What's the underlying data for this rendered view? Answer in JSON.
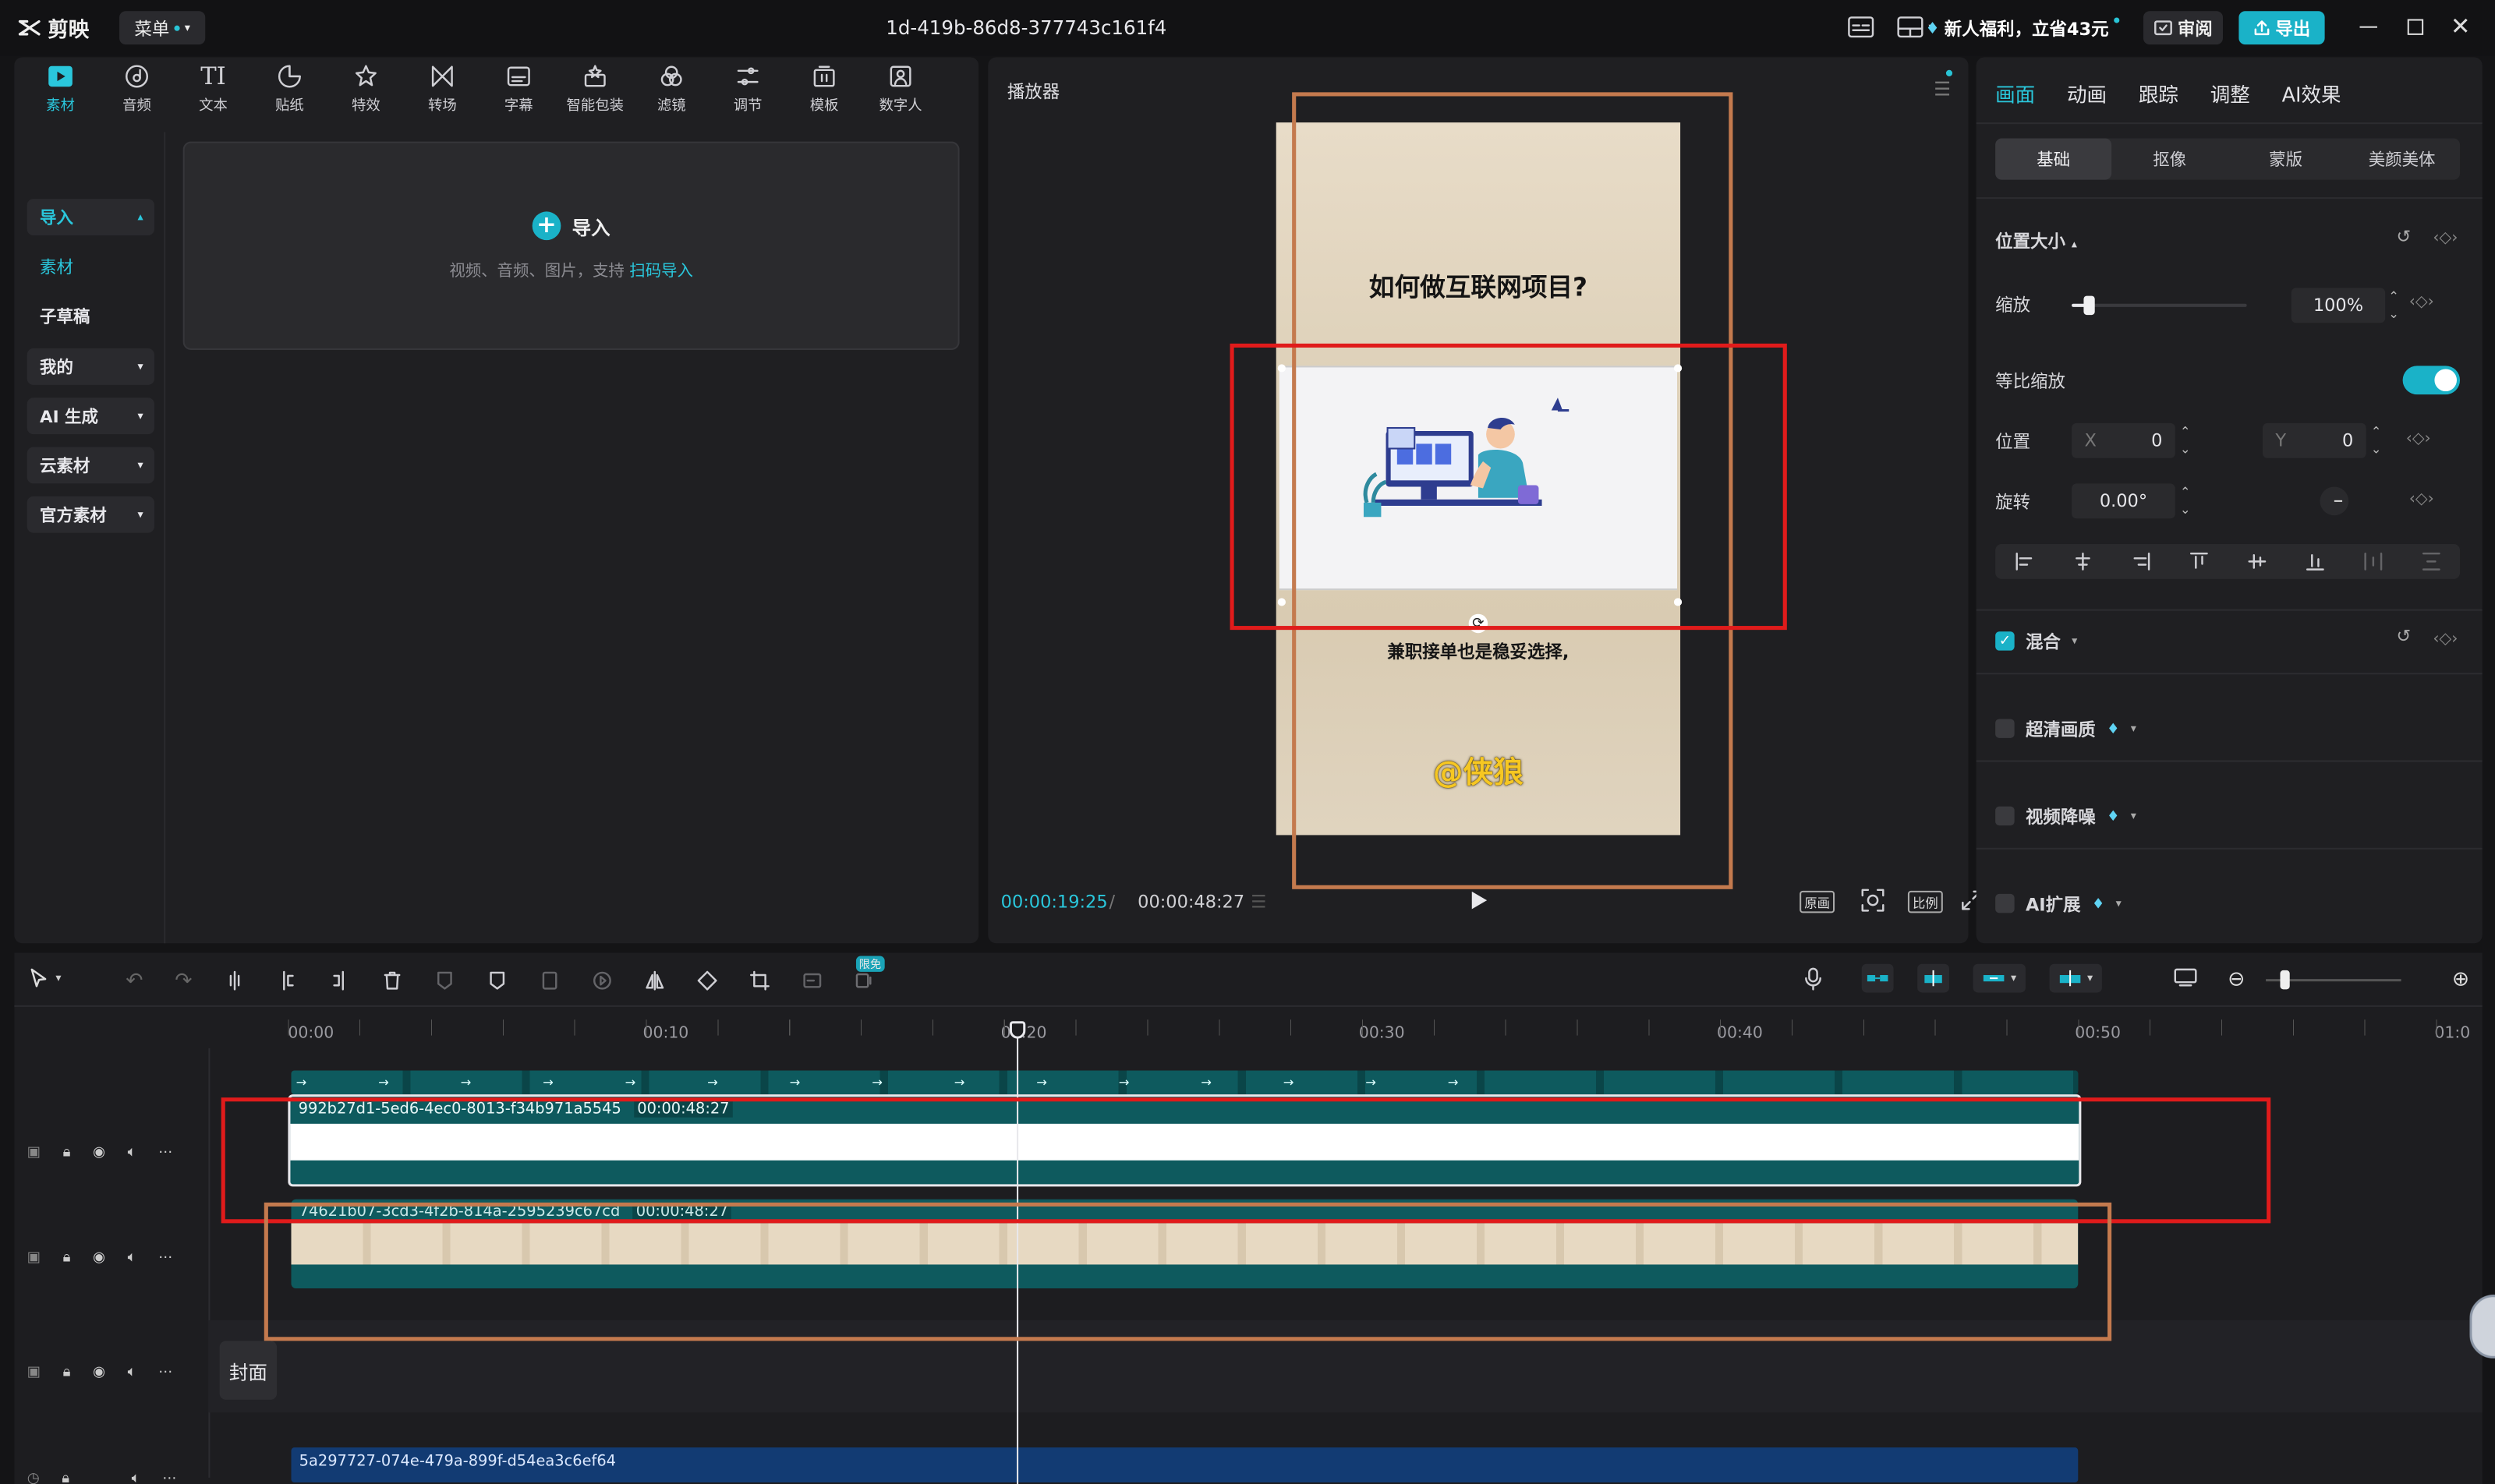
{
  "app": {
    "logo_text": "剪映",
    "menu_label": "菜单",
    "project_title": "1d-419b-86d8-377743c161f4",
    "promo_text": "新人福利，立省43元",
    "review_label": "审阅",
    "export_label": "导出"
  },
  "media_toolbar": [
    {
      "label": "素材",
      "icon": "media-icon",
      "active": true
    },
    {
      "label": "音频",
      "icon": "audio-icon"
    },
    {
      "label": "文本",
      "icon": "text-icon"
    },
    {
      "label": "贴纸",
      "icon": "sticker-icon"
    },
    {
      "label": "特效",
      "icon": "effects-icon"
    },
    {
      "label": "转场",
      "icon": "transition-icon"
    },
    {
      "label": "字幕",
      "icon": "subtitle-icon"
    },
    {
      "label": "智能包装",
      "icon": "smart-pack-icon"
    },
    {
      "label": "滤镜",
      "icon": "filter-icon"
    },
    {
      "label": "调节",
      "icon": "adjust-icon"
    },
    {
      "label": "模板",
      "icon": "template-icon"
    },
    {
      "label": "数字人",
      "icon": "digital-human-icon"
    }
  ],
  "left_sidebar": [
    {
      "label": "导入",
      "style": "box-teal",
      "chevron": "up"
    },
    {
      "label": "素材",
      "style": "teal"
    },
    {
      "label": "子草稿",
      "style": "plain"
    },
    {
      "label": "我的",
      "style": "box",
      "chevron": "down"
    },
    {
      "label": "AI 生成",
      "style": "box",
      "chevron": "down"
    },
    {
      "label": "云素材",
      "style": "box",
      "chevron": "down"
    },
    {
      "label": "官方素材",
      "style": "box",
      "chevron": "down"
    }
  ],
  "import_box": {
    "title": "导入",
    "subtitle": "视频、音频、图片，支持",
    "link": "扫码导入"
  },
  "player": {
    "title": "播放器",
    "video_title": "如何做互联网项目?",
    "video_subtitle": "兼职接单也是稳妥选择,",
    "video_signature": "@侠狼",
    "current_time": "00:00:19:25",
    "separator": "/",
    "total_time": "00:00:48:27",
    "buttons": [
      "原画",
      "比例"
    ]
  },
  "inspector": {
    "tabs": [
      "画面",
      "动画",
      "跟踪",
      "调整",
      "AI效果"
    ],
    "subtabs": [
      "基础",
      "抠像",
      "蒙版",
      "美颜美体"
    ],
    "section_position": "位置大小",
    "scale_label": "缩放",
    "scale_value": "100%",
    "scale_fraction": 0.1,
    "uniform_label": "等比缩放",
    "position_label": "位置",
    "x_label": "X",
    "x_value": "0",
    "y_label": "Y",
    "y_value": "0",
    "rotation_label": "旋转",
    "rotation_value": "0.00°",
    "blend_label": "混合",
    "hd_label": "超清画质",
    "denoise_label": "视频降噪",
    "ai_expand_label": "AI扩展"
  },
  "timeline": {
    "badge_label": "限免",
    "ruler": [
      "00:00",
      "00:10",
      "00:20",
      "00:30",
      "00:40",
      "00:50",
      "01:0"
    ],
    "clips": [
      {
        "name": "992b27d1-5ed6-4ec0-8013-f34b971a5545",
        "duration": "00:00:48:27"
      },
      {
        "name": "74621b07-3cd3-4f2b-814a-2595239c67cd",
        "duration": "00:00:48:27"
      },
      {
        "name": "5a297727-074e-479a-899f-d54ea3c6ef64",
        "duration": ""
      }
    ],
    "cover_label": "封面",
    "zoom_fraction": 0.14
  },
  "colors": {
    "accent": "#1ab2c8",
    "clip_teal": "#0e5a5e",
    "highlight_red": "#e01b1b",
    "highlight_orange": "#c47a4e"
  }
}
